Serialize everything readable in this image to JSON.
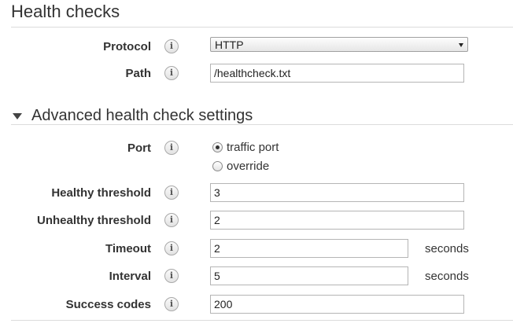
{
  "health_checks": {
    "title": "Health checks",
    "protocol": {
      "label": "Protocol",
      "selected": "HTTP"
    },
    "path": {
      "label": "Path",
      "value": "/healthcheck.txt"
    }
  },
  "advanced": {
    "title": "Advanced health check settings",
    "port": {
      "label": "Port",
      "options": [
        {
          "label": "traffic port",
          "checked": true
        },
        {
          "label": "override",
          "checked": false
        }
      ]
    },
    "healthy_threshold": {
      "label": "Healthy threshold",
      "value": "3"
    },
    "unhealthy_threshold": {
      "label": "Unhealthy threshold",
      "value": "2"
    },
    "timeout": {
      "label": "Timeout",
      "value": "2",
      "unit": "seconds"
    },
    "interval": {
      "label": "Interval",
      "value": "5",
      "unit": "seconds"
    },
    "success_codes": {
      "label": "Success codes",
      "value": "200"
    }
  },
  "info_icon_glyph": "i"
}
